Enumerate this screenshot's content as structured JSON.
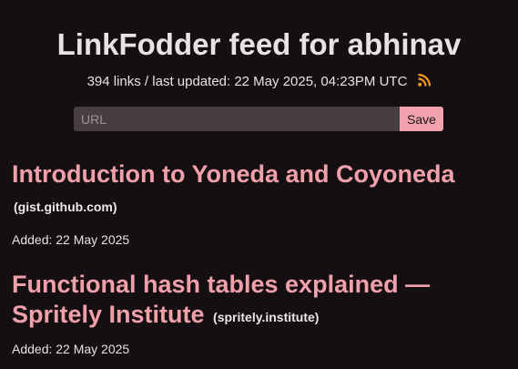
{
  "header": {
    "title": "LinkFodder feed for abhinav",
    "meta": "394 links / last updated: 22 May 2025, 04:23PM UTC",
    "rss_icon": "rss-feed-icon"
  },
  "form": {
    "url_placeholder": "URL",
    "url_value": "",
    "save_label": "Save"
  },
  "entries": [
    {
      "title": "Introduction to Yoneda and Coyoneda",
      "domain": "(gist.github.com)",
      "added": "Added: 22 May 2025"
    },
    {
      "title": "Functional hash tables explained — Spritely Institute",
      "domain": "(spritely.institute)",
      "added": "Added: 22 May 2025"
    }
  ],
  "colors": {
    "background": "#150f11",
    "link": "#f0a0ab",
    "button": "#f2a3ad",
    "input_bg": "#463e41",
    "rss": "#f39a1e"
  }
}
